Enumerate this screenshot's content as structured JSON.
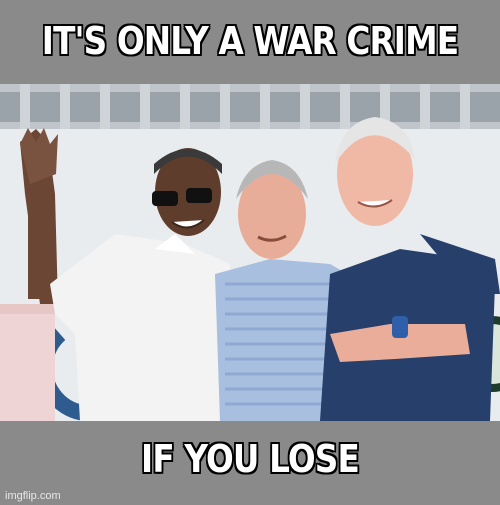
{
  "meme": {
    "top_text": "IT'S ONLY A WAR CRIME",
    "bottom_text": "IF YOU LOSE",
    "watermark": "imgflip.com"
  }
}
